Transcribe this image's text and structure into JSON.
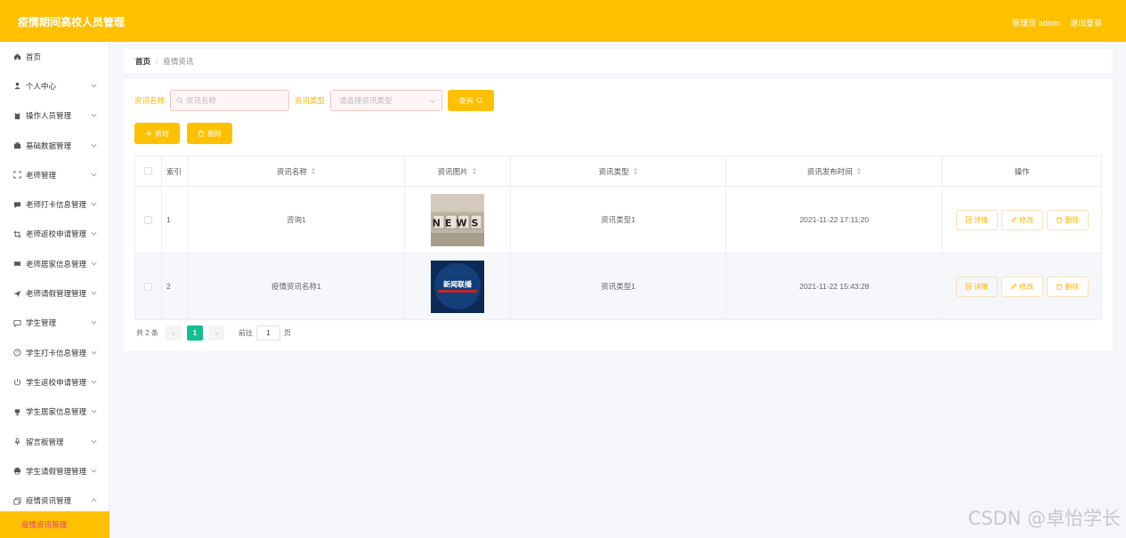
{
  "header": {
    "title": "疫情期间高校人员管理",
    "user": "管理员 admin",
    "logout": "退出登录"
  },
  "sidebar": {
    "items": [
      {
        "label": "首页",
        "icon": "home-icon",
        "arrow": ""
      },
      {
        "label": "个人中心",
        "icon": "user-icon",
        "arrow": "down"
      },
      {
        "label": "操作人员管理",
        "icon": "clipboard-icon",
        "arrow": "down"
      },
      {
        "label": "基础数据管理",
        "icon": "briefcase-icon",
        "arrow": "down"
      },
      {
        "label": "老师管理",
        "icon": "fullscreen-icon",
        "arrow": "down"
      },
      {
        "label": "老师打卡信息管理",
        "icon": "chat-icon",
        "arrow": "down"
      },
      {
        "label": "老师返校申请管理",
        "icon": "crop-icon",
        "arrow": "down"
      },
      {
        "label": "老师居家信息管理",
        "icon": "ticket-icon",
        "arrow": "down"
      },
      {
        "label": "老师请假管理管理",
        "icon": "send-icon",
        "arrow": "down"
      },
      {
        "label": "学生管理",
        "icon": "message-icon",
        "arrow": "down"
      },
      {
        "label": "学生打卡信息管理",
        "icon": "help-icon",
        "arrow": "down"
      },
      {
        "label": "学生返校申请管理",
        "icon": "power-icon",
        "arrow": "down"
      },
      {
        "label": "学生居家信息管理",
        "icon": "cup-icon",
        "arrow": "down"
      },
      {
        "label": "留言板管理",
        "icon": "mic-icon",
        "arrow": "down"
      },
      {
        "label": "学生请假管理管理",
        "icon": "printer-icon",
        "arrow": "down"
      },
      {
        "label": "疫情资讯管理",
        "icon": "copy-icon",
        "arrow": "up"
      }
    ],
    "active_sub": "疫情资讯管理"
  },
  "breadcrumb": {
    "home": "首页",
    "sep": "/",
    "current": "疫情资讯"
  },
  "search": {
    "name_label": "资讯名称",
    "name_placeholder": "资讯名称",
    "type_label": "资讯类型",
    "type_placeholder": "请选择资讯类型",
    "query_button": "查询"
  },
  "actions": {
    "add": "新增",
    "delete": "删除"
  },
  "table": {
    "headers": [
      "",
      "索引",
      "资讯名称",
      "资讯图片",
      "资讯类型",
      "资讯发布时间",
      "操作"
    ],
    "rows": [
      {
        "index": "1",
        "name": "咨询1",
        "image": "news-image",
        "type": "资讯类型1",
        "time": "2021-11-22 17:11:20"
      },
      {
        "index": "2",
        "name": "疫情资讯名称1",
        "image": "news-broadcast-image",
        "type": "资讯类型1",
        "time": "2021-11-22 15:43:28"
      }
    ],
    "op_labels": {
      "detail": "详情",
      "edit": "修改",
      "remove": "删除"
    },
    "thumb1_text": "NEWS",
    "thumb2_text": "新闻联播"
  },
  "pagination": {
    "total": "共 2 条",
    "current": "1",
    "goto": "前往",
    "page_value": "1",
    "page_unit": "页"
  },
  "watermark": "CSDN @卓怡学长",
  "colors": {
    "accent": "#ffc000",
    "active_text": "#e0379c",
    "pager_current": "#14bf8f"
  }
}
